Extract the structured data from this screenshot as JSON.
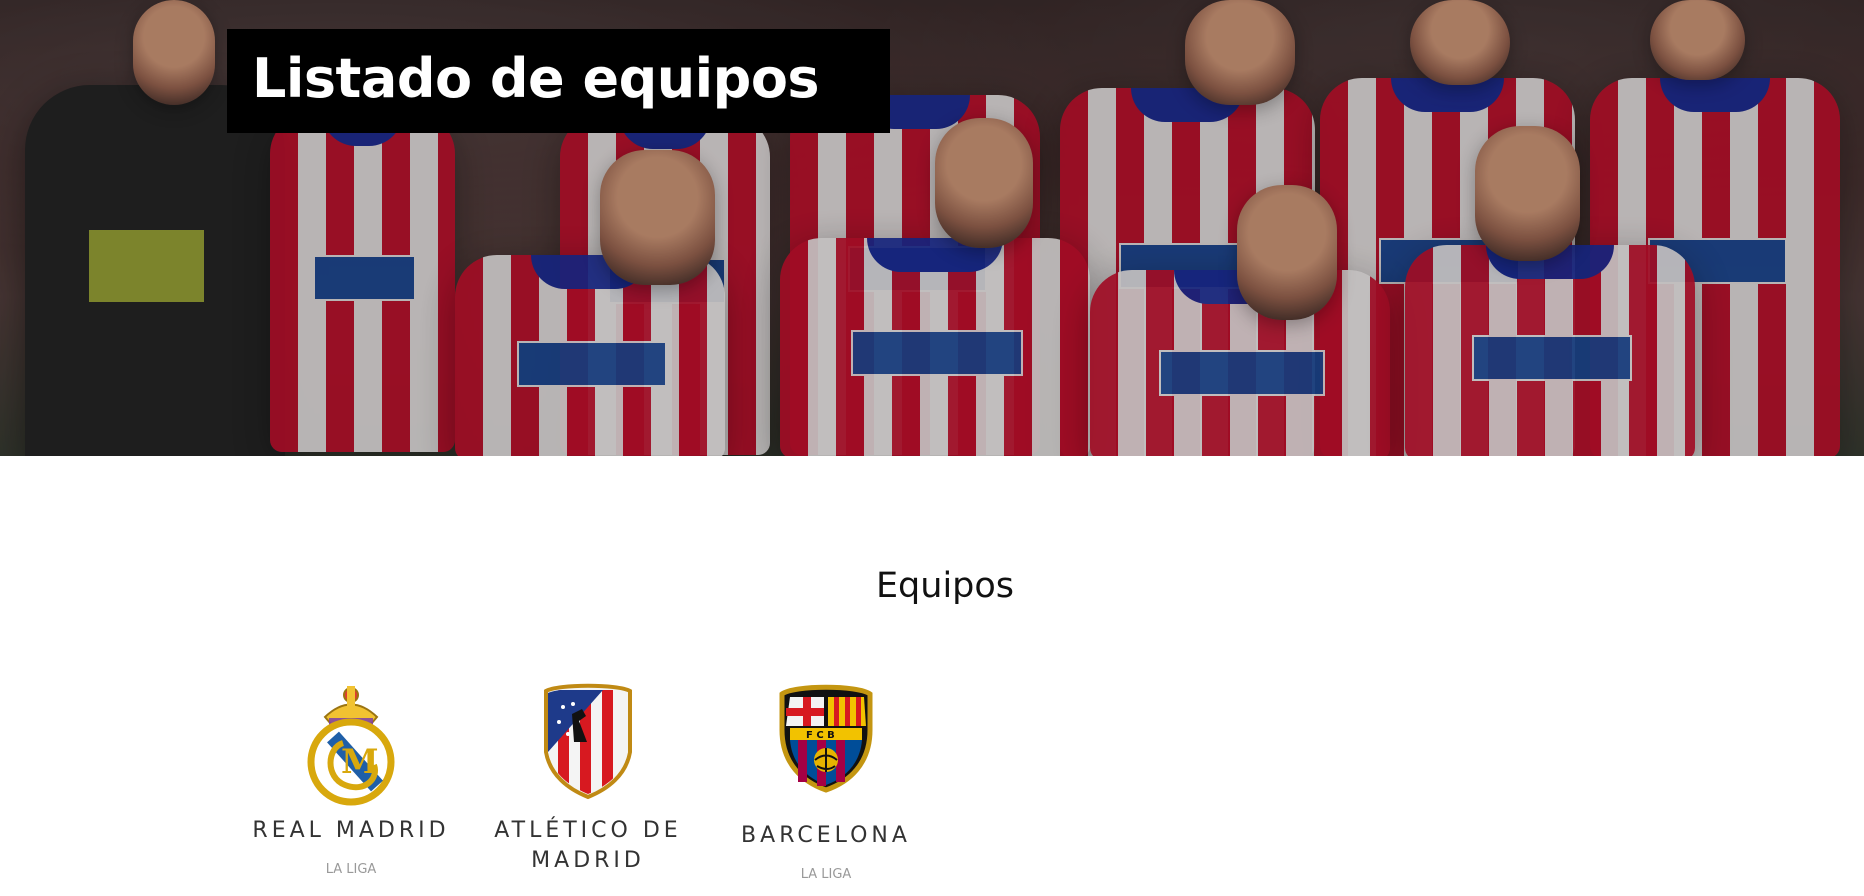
{
  "hero": {
    "title": "Listado de equipos",
    "image_icon": "team-photo"
  },
  "section": {
    "title": "Equipos"
  },
  "teams": [
    {
      "name": "REAL MADRID",
      "league": "LA LIGA",
      "icon": "real-madrid-crest-icon",
      "colors": {
        "primary": "#f2c94c",
        "secondary": "#1f5fa8",
        "background": "#ffffff"
      }
    },
    {
      "name": "ATLÉTICO DE MADRID",
      "league": "",
      "icon": "atletico-madrid-crest-icon",
      "colors": {
        "primary": "#d71920",
        "secondary": "#1e3a8a",
        "accent": "#d4a017"
      }
    },
    {
      "name": "BARCELONA",
      "league": "LA LIGA",
      "icon": "barcelona-crest-icon",
      "colors": {
        "primary": "#a50044",
        "secondary": "#004d98",
        "accent": "#edbb00"
      }
    }
  ],
  "colors": {
    "title_box": "#000000",
    "title_text": "#ffffff",
    "team_text": "#333333",
    "league_text": "#999999"
  }
}
